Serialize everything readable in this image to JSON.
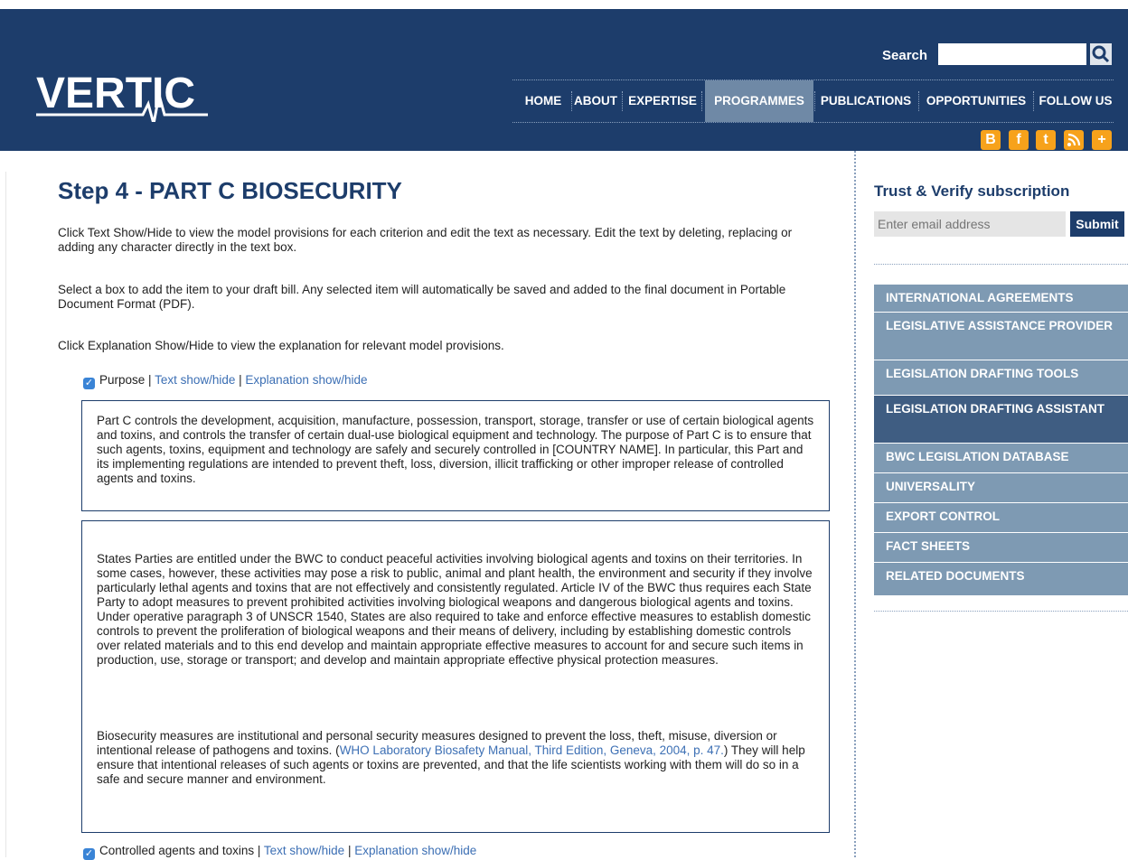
{
  "header": {
    "logo_text": "VERTIC",
    "search_label": "Search",
    "nav": [
      "HOME",
      "ABOUT",
      "EXPERTISE",
      "PROGRAMMES",
      "PUBLICATIONS",
      "OPPORTUNITIES",
      "FOLLOW US"
    ],
    "active_nav": "PROGRAMMES",
    "social": [
      "blogger-icon",
      "facebook-icon",
      "twitter-icon",
      "rss-icon",
      "plus-icon"
    ]
  },
  "main": {
    "title": "Step 4 - PART C BIOSECURITY",
    "intro1": "Click Text Show/Hide to view the model provisions for each criterion and edit the text as necessary. Edit the text by deleting, replacing or adding any character directly in the text box.",
    "intro2": "Select a box to add the item to your draft bill. Any selected item will automatically be saved and added to the final document in Portable Document Format (PDF).",
    "intro3": "Click Explanation Show/Hide to view the explanation for relevant model provisions.",
    "sep": " | ",
    "items": [
      {
        "label": "Purpose",
        "text_link": "Text show/hide",
        "expl_link": "Explanation show/hide"
      },
      {
        "label": "Controlled agents and toxins",
        "text_link": "Text show/hide",
        "expl_link": "Explanation show/hide"
      }
    ],
    "provision_text": "Part C controls the development, acquisition, manufacture, possession, transport, storage, transfer or use of certain biological agents and toxins, and controls the transfer of certain dual-use biological equipment and technology. The purpose of Part C is to ensure that such agents, toxins, equipment and technology are safely and securely controlled in [COUNTRY NAME]. In particular, this Part and its implementing regulations are intended to prevent theft, loss, diversion, illicit trafficking or other improper release of controlled agents and toxins.",
    "explanation_p1": "States Parties are entitled under the BWC to conduct peaceful activities involving biological agents and toxins on their territories. In some cases, however, these activities may pose a risk to public, animal and plant health, the environment and security if they involve particularly lethal agents and toxins that are not effectively and consistently regulated. Article IV of the BWC thus requires each State Party to adopt measures to prevent prohibited activities involving biological weapons and dangerous biological agents and toxins. Under operative paragraph 3 of UNSCR 1540, States are also required to take and enforce effective measures to establish domestic controls to prevent the proliferation of biological weapons and their means of delivery, including by establishing domestic controls over related materials and to this end develop and maintain appropriate effective measures to account for and secure such items in production, use, storage or transport; and develop and maintain appropriate effective physical protection measures.",
    "explanation_p2_before": "Biosecurity measures are institutional and personal security measures designed to prevent the loss, theft, misuse, diversion or intentional release of pathogens and toxins. (",
    "explanation_p2_link": "WHO Laboratory Biosafety Manual, Third Edition, Geneva, 2004, p. 47.",
    "explanation_p2_after": ") They will help ensure that intentional releases of such agents or toxins are prevented, and that the life scientists working with them will do so in a safe and secure manner and environment."
  },
  "sidebar": {
    "subscription_title": "Trust & Verify subscription",
    "email_placeholder": "Enter email address",
    "submit_label": "Submit",
    "menu": [
      "INTERNATIONAL AGREEMENTS",
      "LEGISLATIVE ASSISTANCE PROVIDER",
      "LEGISLATION DRAFTING TOOLS",
      "LEGISLATION DRAFTING ASSISTANT",
      "BWC LEGISLATION DATABASE",
      "UNIVERSALITY",
      "EXPORT CONTROL",
      "FACT SHEETS",
      "RELATED DOCUMENTS"
    ],
    "active_menu": "LEGISLATION DRAFTING ASSISTANT"
  },
  "colors": {
    "header_bg": "#1d3d6b",
    "nav_active": "#6f89a6",
    "sidebar_item": "#7e9ab3",
    "sidebar_active": "#3f5d82",
    "social": "#f7a21b",
    "link": "#3c6fb4"
  }
}
